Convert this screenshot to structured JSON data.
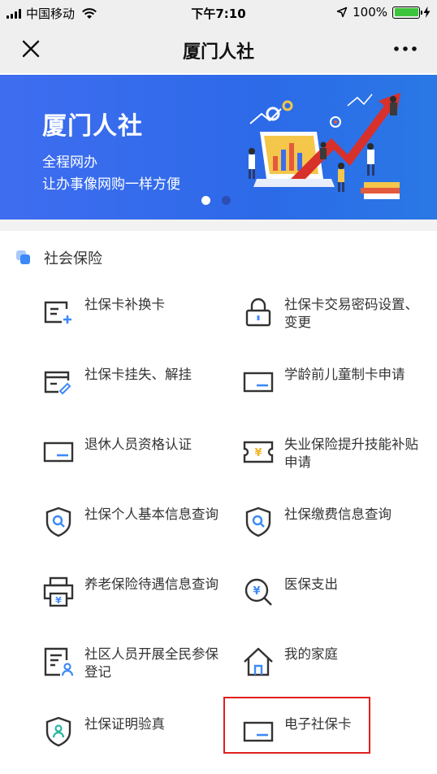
{
  "status_bar": {
    "carrier": "中国移动",
    "time": "下午7:10",
    "battery_percent_label": "100%",
    "battery_level": 1.0
  },
  "nav": {
    "title": "厦门人社",
    "close_icon": "close-icon",
    "more_icon": "more-icon"
  },
  "banner": {
    "title": "厦门人社",
    "subtitle_line1": "全程网办",
    "subtitle_line2": "让办事像网购一样方便",
    "page_count": 2,
    "active_page": 1
  },
  "section": {
    "title": "社会保险"
  },
  "items": [
    {
      "label": "社保卡补换卡",
      "icon": "card-replace-icon"
    },
    {
      "label": "社保卡交易密码设置、变更",
      "icon": "lock-icon"
    },
    {
      "label": "社保卡挂失、解挂",
      "icon": "card-report-loss-icon"
    },
    {
      "label": "学龄前儿童制卡申请",
      "icon": "card-icon"
    },
    {
      "label": "退休人员资格认证",
      "icon": "card-icon"
    },
    {
      "label": "失业保险提升技能补贴申请",
      "icon": "ticket-yen-icon"
    },
    {
      "label": "社保个人基本信息查询",
      "icon": "shield-search-icon"
    },
    {
      "label": "社保缴费信息查询",
      "icon": "shield-search-icon"
    },
    {
      "label": "养老保险待遇信息查询",
      "icon": "printer-yen-icon"
    },
    {
      "label": "医保支出",
      "icon": "search-yen-icon"
    },
    {
      "label": "社区人员开展全民参保登记",
      "icon": "document-person-icon"
    },
    {
      "label": "我的家庭",
      "icon": "house-icon"
    },
    {
      "label": "社保证明验真",
      "icon": "shield-person-icon"
    },
    {
      "label": "电子社保卡",
      "icon": "card-icon"
    }
  ],
  "colors": {
    "accent": "#3d8af7",
    "banner": "#3f6df0",
    "highlight_border": "#e02020",
    "icon_stroke": "#333333"
  }
}
